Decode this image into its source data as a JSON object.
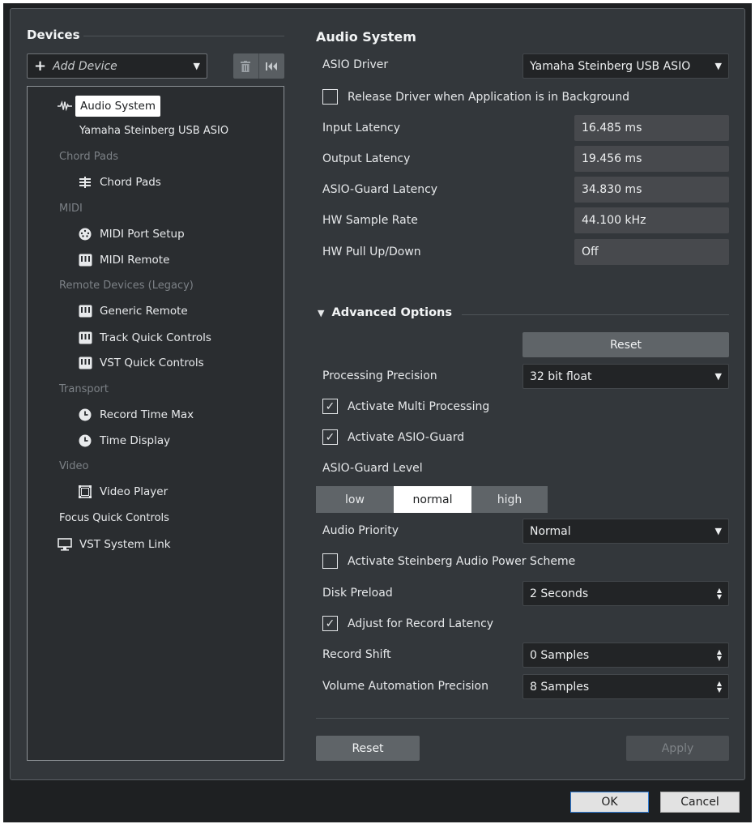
{
  "left": {
    "title": "Devices",
    "add_device": "Add Device",
    "tree": {
      "audio_system": "Audio System",
      "yamaha": "Yamaha Steinberg USB ASIO",
      "cat_chord_pads": "Chord Pads",
      "chord_pads": "Chord Pads",
      "cat_midi": "MIDI",
      "midi_port_setup": "MIDI Port Setup",
      "midi_remote": "MIDI Remote",
      "cat_remote": "Remote Devices (Legacy)",
      "generic_remote": "Generic Remote",
      "track_quick_controls": "Track Quick Controls",
      "vst_quick_controls": "VST Quick Controls",
      "cat_transport": "Transport",
      "record_time_max": "Record Time Max",
      "time_display": "Time Display",
      "cat_video": "Video",
      "video_player": "Video Player",
      "focus_quick_controls": "Focus Quick Controls",
      "vst_system_link": "VST System Link"
    }
  },
  "right": {
    "title": "Audio System",
    "asio_driver_label": "ASIO Driver",
    "asio_driver_value": "Yamaha Steinberg USB ASIO",
    "release_driver": "Release Driver when Application is in Background",
    "input_latency_label": "Input Latency",
    "input_latency": "16.485 ms",
    "output_latency_label": "Output Latency",
    "output_latency": "19.456 ms",
    "asio_guard_latency_label": "ASIO-Guard Latency",
    "asio_guard_latency": "34.830 ms",
    "hw_sample_rate_label": "HW Sample Rate",
    "hw_sample_rate": "44.100 kHz",
    "hw_pull_label": "HW Pull Up/Down",
    "hw_pull": "Off",
    "advanced_title": "Advanced Options",
    "reset_top": "Reset",
    "processing_precision_label": "Processing Precision",
    "processing_precision": "32 bit float",
    "activate_multi": "Activate Multi Processing",
    "activate_asio_guard": "Activate ASIO-Guard",
    "asio_guard_level_label": "ASIO-Guard Level",
    "level_low": "low",
    "level_normal": "normal",
    "level_high": "high",
    "audio_priority_label": "Audio Priority",
    "audio_priority": "Normal",
    "power_scheme": "Activate Steinberg Audio Power Scheme",
    "disk_preload_label": "Disk Preload",
    "disk_preload": "2 Seconds",
    "adjust_record_latency": "Adjust for Record Latency",
    "record_shift_label": "Record Shift",
    "record_shift": "0 Samples",
    "volume_auto_label": "Volume Automation Precision",
    "volume_auto": "8 Samples",
    "reset_bottom": "Reset",
    "apply": "Apply"
  },
  "dialog": {
    "ok": "OK",
    "cancel": "Cancel"
  },
  "colors": {
    "panel": "#33373b",
    "field": "#47494d",
    "dropdown": "#222426",
    "selected_segment": "#ffffff"
  }
}
